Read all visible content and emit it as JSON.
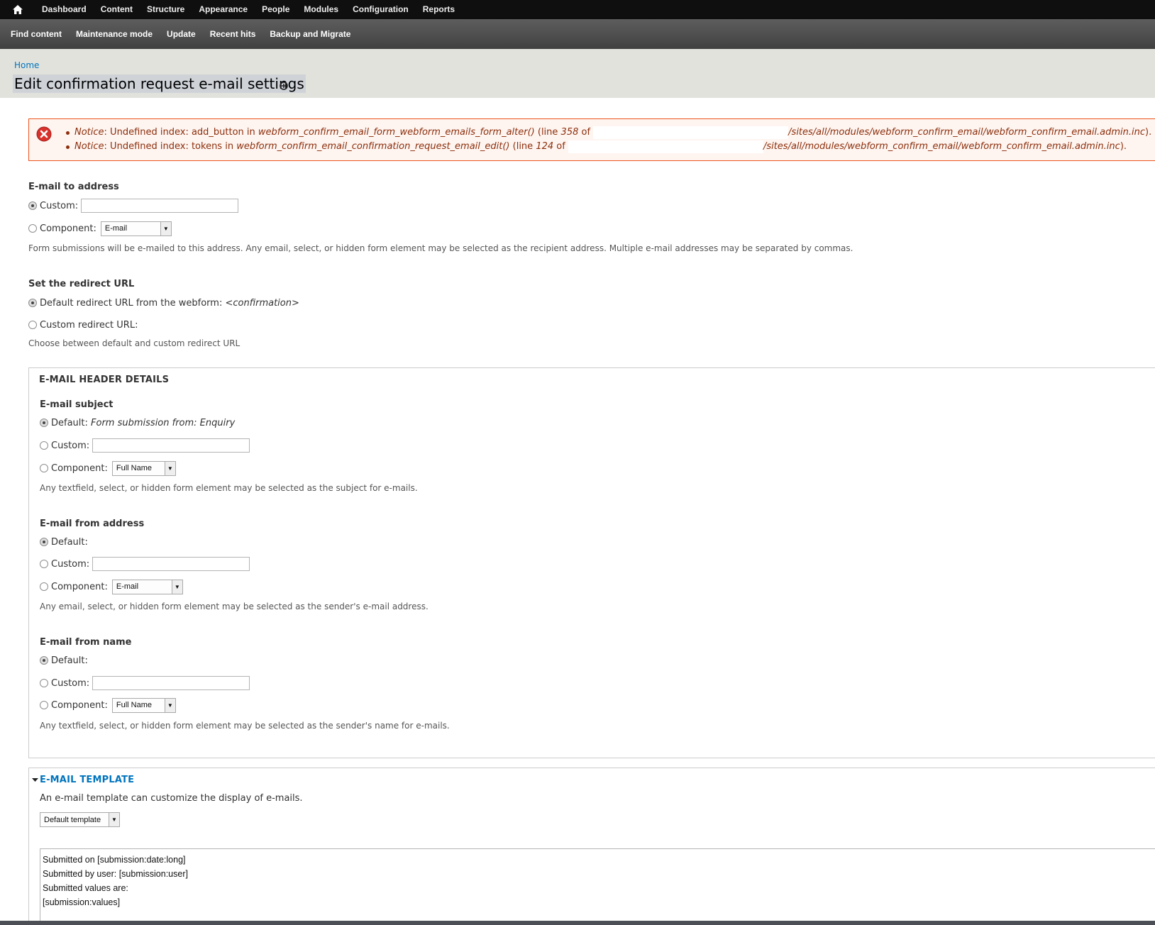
{
  "toolbar": {
    "items": [
      "Dashboard",
      "Content",
      "Structure",
      "Appearance",
      "People",
      "Modules",
      "Configuration",
      "Reports"
    ]
  },
  "shortcuts": {
    "items": [
      "Find content",
      "Maintenance mode",
      "Update",
      "Recent hits",
      "Backup and Migrate"
    ]
  },
  "breadcrumb": {
    "home": "Home"
  },
  "page": {
    "title": "Edit confirmation request e-mail settings"
  },
  "messages": [
    {
      "type": "Notice",
      "text": ": Undefined index: add_button in ",
      "function": "webform_confirm_email_form_webform_emails_form_alter()",
      "line_prefix": " (line ",
      "line": "358",
      "of": " of ",
      "path": "/sites/all/modules/webform_confirm_email/webform_confirm_email.admin.inc",
      "end": ")."
    },
    {
      "type": "Notice",
      "text": ": Undefined index: tokens in ",
      "function": "webform_confirm_email_confirmation_request_email_edit()",
      "line_prefix": " (line ",
      "line": "124",
      "of": " of ",
      "path": "/sites/all/modules/webform_confirm_email/webform_confirm_email.admin.inc",
      "end": ")."
    }
  ],
  "email_to": {
    "label": "E-mail to address",
    "custom_label": "Custom:",
    "custom_value": "",
    "component_label": "Component:",
    "component_value": "E-mail",
    "description": "Form submissions will be e-mailed to this address. Any email, select, or hidden form element may be selected as the recipient address. Multiple e-mail addresses may be separated by commas."
  },
  "redirect": {
    "label": "Set the redirect URL",
    "default_label": "Default redirect URL from the webform: ",
    "default_value": "<confirmation>",
    "custom_label": "Custom redirect URL:",
    "description": "Choose between default and custom redirect URL"
  },
  "header_details": {
    "legend": "E-MAIL HEADER DETAILS",
    "subject": {
      "label": "E-mail subject",
      "default_label": "Default: ",
      "default_value": "Form submission from: Enquiry",
      "custom_label": "Custom:",
      "component_label": "Component:",
      "component_value": "Full Name",
      "description": "Any textfield, select, or hidden form element may be selected as the subject for e-mails."
    },
    "from_address": {
      "label": "E-mail from address",
      "default_label": "Default:",
      "custom_label": "Custom:",
      "component_label": "Component:",
      "component_value": "E-mail",
      "description": "Any email, select, or hidden form element may be selected as the sender's e-mail address."
    },
    "from_name": {
      "label": "E-mail from name",
      "default_label": "Default:",
      "custom_label": "Custom:",
      "component_label": "Component:",
      "component_value": "Full Name",
      "description": "Any textfield, select, or hidden form element may be selected as the sender's name for e-mails."
    }
  },
  "template": {
    "legend": "E-MAIL TEMPLATE",
    "description": "An e-mail template can customize the display of e-mails.",
    "select_value": "Default template",
    "body_lines": [
      "Submitted on [submission:date:long]",
      "Submitted by user: [submission:user]",
      "Submitted values are:",
      "[submission:values]"
    ]
  }
}
